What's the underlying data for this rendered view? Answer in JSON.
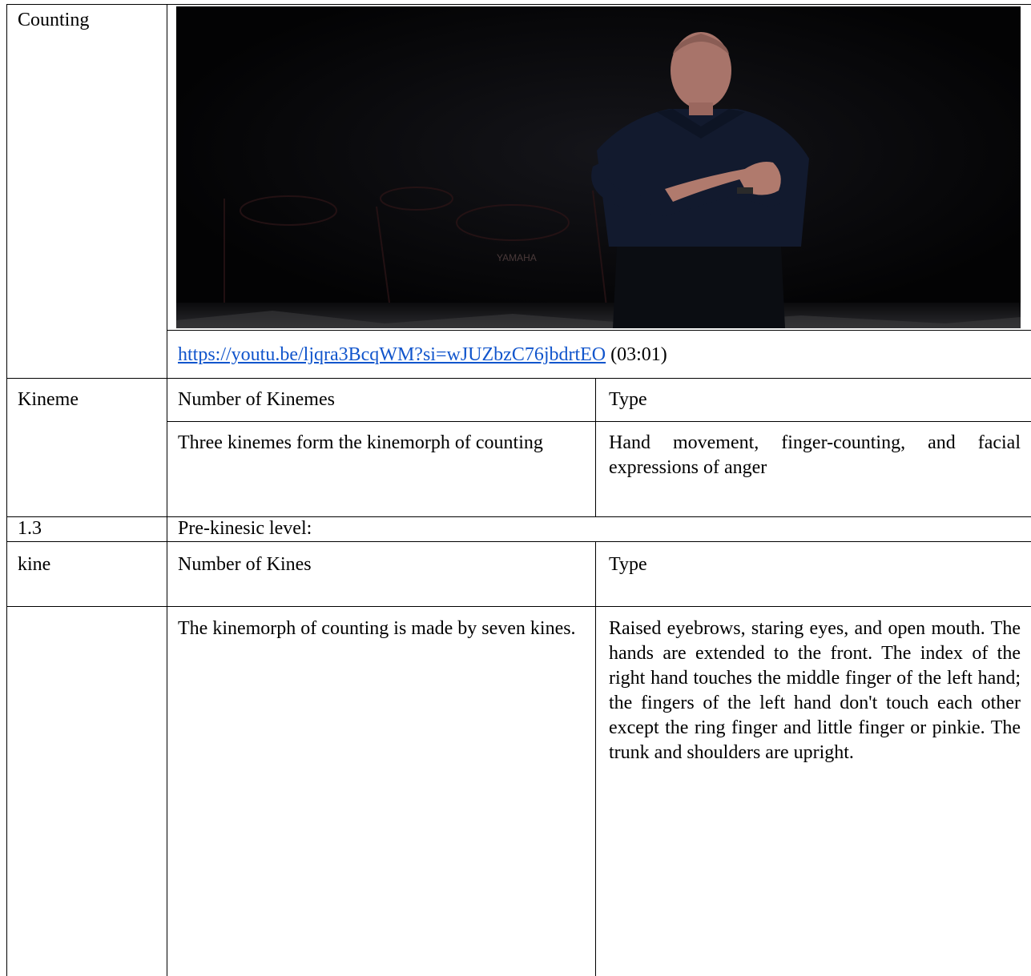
{
  "counting_row": {
    "label": "Counting",
    "video_link": "https://youtu.be/ljqra3BcqWM?si=wJUZbzC76jbdrtEO",
    "timestamp": "(03:01)",
    "stage_logo": "YAMAHA"
  },
  "kineme_row": {
    "label": "Kineme",
    "col_number_header": "Number of Kinemes",
    "col_type_header": "Type",
    "number_value": "Three kinemes form the kinemorph of counting",
    "type_value": "Hand movement, finger-counting, and facial expressions of anger"
  },
  "section_row": {
    "label": "1.3",
    "title": "Pre-kinesic level:"
  },
  "kine_row": {
    "label": "kine",
    "col_number_header": "Number of Kines",
    "col_type_header": "Type",
    "number_value": "The kinemorph of counting is made by seven kines.",
    "type_value": "Raised eyebrows, staring eyes, and open mouth. The hands are extended to the front. The index of the right hand touches the middle finger of the left hand; the fingers of the left hand don't touch each other except the ring finger and little finger or pinkie. The trunk and shoulders are upright."
  }
}
